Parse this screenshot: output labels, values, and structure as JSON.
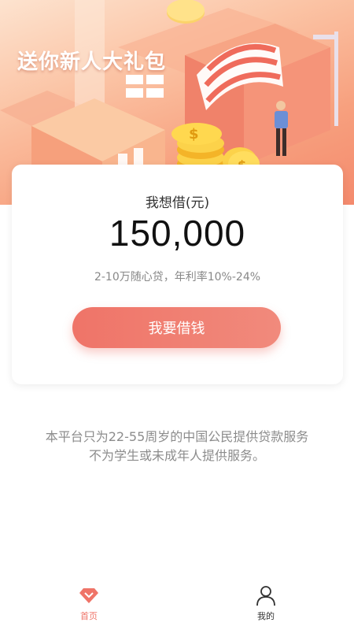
{
  "hero": {
    "title": "送你新人大礼包"
  },
  "loan_card": {
    "label": "我想借(元)",
    "amount": "150,000",
    "rate_text": "2-10万随心贷，年利率10%-24%",
    "button_label": "我要借钱"
  },
  "notice": {
    "line1": "本平台只为22-55周岁的中国公民提供贷款服务",
    "line2": "不为学生或未成年人提供服务。"
  },
  "bottom_nav": {
    "items": [
      {
        "label": "首页",
        "icon": "diamond-home-icon",
        "active": true
      },
      {
        "label": "我的",
        "icon": "user-icon",
        "active": false
      }
    ]
  },
  "colors": {
    "accent": "#ef7468",
    "text_muted": "#8c8c8c"
  }
}
